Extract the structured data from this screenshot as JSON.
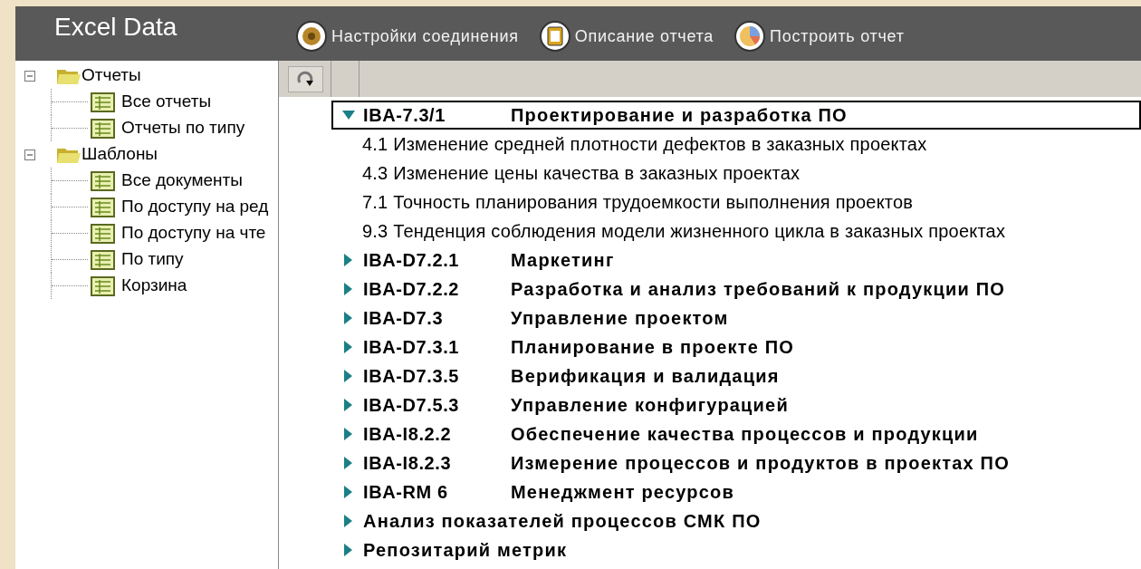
{
  "header": {
    "title": "Excel Data",
    "buttons": [
      {
        "label": "Настройки соединения",
        "kind": "gear"
      },
      {
        "label": "Описание отчета",
        "kind": "clipboard"
      },
      {
        "label": "Построить отчет",
        "kind": "chart"
      }
    ]
  },
  "tree": [
    {
      "label": "Отчеты",
      "expanded": true,
      "children": [
        {
          "label": "Все отчеты"
        },
        {
          "label": "Отчеты по типу"
        }
      ]
    },
    {
      "label": "Шаблоны",
      "expanded": true,
      "children": [
        {
          "label": "Все документы"
        },
        {
          "label": "По доступу на ред"
        },
        {
          "label": "По доступу на чте"
        },
        {
          "label": "По типу"
        },
        {
          "label": "Корзина"
        }
      ]
    }
  ],
  "groups": [
    {
      "code": "IBA-7.3/1",
      "title": "Проектирование и разработка ПО",
      "expanded": true,
      "selected": true,
      "items": [
        "4.1 Изменение средней плотности дефектов в заказных проектах",
        "4.3 Изменение цены качества в заказных проектах",
        "7.1 Точность планирования трудоемкости выполнения проектов",
        "9.3 Тенденция соблюдения модели жизненного цикла в заказных проектах"
      ]
    },
    {
      "code": "IBA-D7.2.1",
      "title": "Маркетинг",
      "expanded": false,
      "selected": false
    },
    {
      "code": "IBA-D7.2.2",
      "title": "Разработка и анализ требований к продукции ПО",
      "expanded": false,
      "selected": false
    },
    {
      "code": "IBA-D7.3",
      "title": "Управление проектом",
      "expanded": false,
      "selected": false
    },
    {
      "code": "IBA-D7.3.1",
      "title": "Планирование в проекте ПО",
      "expanded": false,
      "selected": false
    },
    {
      "code": "IBA-D7.3.5",
      "title": "Верификация и валидация",
      "expanded": false,
      "selected": false
    },
    {
      "code": "IBA-D7.5.3",
      "title": "Управление конфигурацией",
      "expanded": false,
      "selected": false
    },
    {
      "code": "IBA-I8.2.2",
      "title": "Обеспечение качества процессов и продукции",
      "expanded": false,
      "selected": false
    },
    {
      "code": "IBA-I8.2.3",
      "title": "Измерение процессов и продуктов в проектах ПО",
      "expanded": false,
      "selected": false
    },
    {
      "code": "IBA-RM 6",
      "title": "Менеджмент ресурсов",
      "expanded": false,
      "selected": false
    },
    {
      "title": "Анализ показателей процессов СМК ПО",
      "expanded": false,
      "selected": false
    },
    {
      "title": "Репозитарий метрик",
      "expanded": false,
      "selected": false
    }
  ]
}
